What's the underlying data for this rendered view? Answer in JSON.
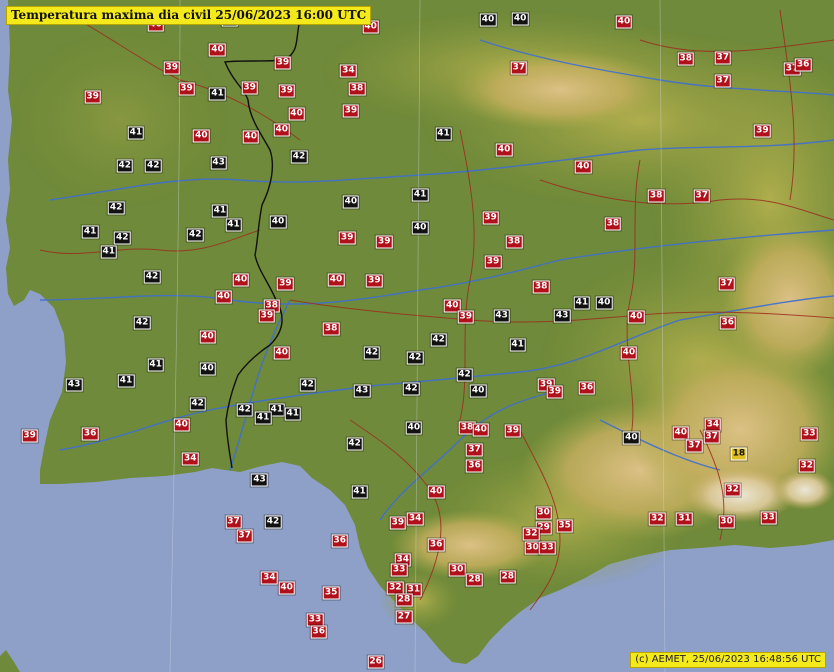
{
  "title": "Temperatura maxima dia civil   25/06/2023 16:00 UTC",
  "footer": "(c) AEMET, 25/06/2023 16:48:56 UTC",
  "colors": {
    "sea": "#8ea0c8",
    "lowland": "#6f8a3a",
    "hills": "#a9ab49",
    "mountains": "#d4b06c",
    "peaks": "#ece4d2",
    "rivers": "#3f6fd0",
    "province_borders": "#9b2d1d",
    "country_border": "#111111",
    "label_black": "#111111",
    "label_red": "#b0101a",
    "label_orange": "#e0c020",
    "title_bg": "#f3e91b"
  },
  "icons": [
    "relief-map"
  ],
  "stations": [
    {
      "value": "40",
      "lon": -6.82,
      "lat": 39.76,
      "cls": "red"
    },
    {
      "value": "40",
      "lon": -3.94,
      "lat": 39.75,
      "cls": "black"
    },
    {
      "value": "40",
      "lon": -4.2,
      "lat": 39.74,
      "cls": "black"
    },
    {
      "value": "40",
      "lon": -6.29,
      "lat": 39.74,
      "cls": "black"
    },
    {
      "value": "40",
      "lon": -6.89,
      "lat": 39.71,
      "cls": "red"
    },
    {
      "value": "40",
      "lon": -5.15,
      "lat": 39.69,
      "cls": "red"
    },
    {
      "value": "40",
      "lon": -3.1,
      "lat": 39.73,
      "cls": "red"
    },
    {
      "value": "40",
      "lon": -6.39,
      "lat": 39.53,
      "cls": "red"
    },
    {
      "value": "38",
      "lon": -2.6,
      "lat": 39.47,
      "cls": "red"
    },
    {
      "value": "37",
      "lon": -2.3,
      "lat": 39.48,
      "cls": "red"
    },
    {
      "value": "39",
      "lon": -5.86,
      "lat": 39.44,
      "cls": "red"
    },
    {
      "value": "39",
      "lon": -6.76,
      "lat": 39.41,
      "cls": "red"
    },
    {
      "value": "34",
      "lon": -5.33,
      "lat": 39.39,
      "cls": "red"
    },
    {
      "value": "37",
      "lon": -3.95,
      "lat": 39.41,
      "cls": "red"
    },
    {
      "value": "37",
      "lon": -2.3,
      "lat": 39.32,
      "cls": "red"
    },
    {
      "value": "37",
      "lon": -1.74,
      "lat": 39.4,
      "cls": "red"
    },
    {
      "value": "36",
      "lon": -1.65,
      "lat": 39.43,
      "cls": "red"
    },
    {
      "value": "39",
      "lon": -6.64,
      "lat": 39.26,
      "cls": "red"
    },
    {
      "value": "39",
      "lon": -6.13,
      "lat": 39.27,
      "cls": "red"
    },
    {
      "value": "39",
      "lon": -5.83,
      "lat": 39.25,
      "cls": "red"
    },
    {
      "value": "38",
      "lon": -5.26,
      "lat": 39.26,
      "cls": "red"
    },
    {
      "value": "41",
      "lon": -6.39,
      "lat": 39.23,
      "cls": "black"
    },
    {
      "value": "39",
      "lon": -7.4,
      "lat": 39.21,
      "cls": "red"
    },
    {
      "value": "40",
      "lon": -5.75,
      "lat": 39.09,
      "cls": "red"
    },
    {
      "value": "39",
      "lon": -5.31,
      "lat": 39.11,
      "cls": "red"
    },
    {
      "value": "40",
      "lon": -5.87,
      "lat": 38.98,
      "cls": "red"
    },
    {
      "value": "40",
      "lon": -6.12,
      "lat": 38.93,
      "cls": "red"
    },
    {
      "value": "41",
      "lon": -7.05,
      "lat": 38.96,
      "cls": "black"
    },
    {
      "value": "41",
      "lon": -4.56,
      "lat": 38.95,
      "cls": "black"
    },
    {
      "value": "40",
      "lon": -6.52,
      "lat": 38.94,
      "cls": "red"
    },
    {
      "value": "40",
      "lon": -4.07,
      "lat": 38.84,
      "cls": "red"
    },
    {
      "value": "39",
      "lon": -1.98,
      "lat": 38.97,
      "cls": "red"
    },
    {
      "value": "40",
      "lon": -3.43,
      "lat": 38.72,
      "cls": "red"
    },
    {
      "value": "42",
      "lon": -7.14,
      "lat": 38.73,
      "cls": "black"
    },
    {
      "value": "42",
      "lon": -6.91,
      "lat": 38.73,
      "cls": "black"
    },
    {
      "value": "43",
      "lon": -6.38,
      "lat": 38.75,
      "cls": "black"
    },
    {
      "value": "42",
      "lon": -5.73,
      "lat": 38.79,
      "cls": "black"
    },
    {
      "value": "41",
      "lon": -4.75,
      "lat": 38.53,
      "cls": "black"
    },
    {
      "value": "38",
      "lon": -2.84,
      "lat": 38.52,
      "cls": "red"
    },
    {
      "value": "37",
      "lon": -2.47,
      "lat": 38.52,
      "cls": "red"
    },
    {
      "value": "40",
      "lon": -5.31,
      "lat": 38.48,
      "cls": "black"
    },
    {
      "value": "42",
      "lon": -7.21,
      "lat": 38.44,
      "cls": "black"
    },
    {
      "value": "41",
      "lon": -6.37,
      "lat": 38.42,
      "cls": "black"
    },
    {
      "value": "39",
      "lon": -4.18,
      "lat": 38.37,
      "cls": "red"
    },
    {
      "value": "41",
      "lon": -6.26,
      "lat": 38.32,
      "cls": "black"
    },
    {
      "value": "40",
      "lon": -5.9,
      "lat": 38.34,
      "cls": "black"
    },
    {
      "value": "38",
      "lon": -3.19,
      "lat": 38.33,
      "cls": "red"
    },
    {
      "value": "41",
      "lon": -7.42,
      "lat": 38.27,
      "cls": "black"
    },
    {
      "value": "42",
      "lon": -7.16,
      "lat": 38.23,
      "cls": "black"
    },
    {
      "value": "42",
      "lon": -6.57,
      "lat": 38.25,
      "cls": "black"
    },
    {
      "value": "39",
      "lon": -5.34,
      "lat": 38.23,
      "cls": "red"
    },
    {
      "value": "39",
      "lon": -5.04,
      "lat": 38.2,
      "cls": "red"
    },
    {
      "value": "40",
      "lon": -4.75,
      "lat": 38.3,
      "cls": "black"
    },
    {
      "value": "38",
      "lon": -3.99,
      "lat": 38.2,
      "cls": "red"
    },
    {
      "value": "41",
      "lon": -7.27,
      "lat": 38.13,
      "cls": "black"
    },
    {
      "value": "42",
      "lon": -6.92,
      "lat": 37.96,
      "cls": "black"
    },
    {
      "value": "39",
      "lon": -4.16,
      "lat": 38.06,
      "cls": "red"
    },
    {
      "value": "40",
      "lon": -6.2,
      "lat": 37.94,
      "cls": "red"
    },
    {
      "value": "39",
      "lon": -5.84,
      "lat": 37.91,
      "cls": "red"
    },
    {
      "value": "40",
      "lon": -5.43,
      "lat": 37.94,
      "cls": "red"
    },
    {
      "value": "39",
      "lon": -5.12,
      "lat": 37.93,
      "cls": "red"
    },
    {
      "value": "38",
      "lon": -3.77,
      "lat": 37.89,
      "cls": "red"
    },
    {
      "value": "37",
      "lon": -2.27,
      "lat": 37.91,
      "cls": "red"
    },
    {
      "value": "40",
      "lon": -6.34,
      "lat": 37.82,
      "cls": "red"
    },
    {
      "value": "38",
      "lon": -5.95,
      "lat": 37.76,
      "cls": "red"
    },
    {
      "value": "39",
      "lon": -5.99,
      "lat": 37.69,
      "cls": "red"
    },
    {
      "value": "40",
      "lon": -4.49,
      "lat": 37.76,
      "cls": "red"
    },
    {
      "value": "39",
      "lon": -4.38,
      "lat": 37.68,
      "cls": "red"
    },
    {
      "value": "41",
      "lon": -3.44,
      "lat": 37.78,
      "cls": "black"
    },
    {
      "value": "40",
      "lon": -3.26,
      "lat": 37.78,
      "cls": "black"
    },
    {
      "value": "43",
      "lon": -4.09,
      "lat": 37.69,
      "cls": "black"
    },
    {
      "value": "43",
      "lon": -3.6,
      "lat": 37.69,
      "cls": "black"
    },
    {
      "value": "40",
      "lon": -3.0,
      "lat": 37.68,
      "cls": "red"
    },
    {
      "value": "42",
      "lon": -7.0,
      "lat": 37.64,
      "cls": "black"
    },
    {
      "value": "38",
      "lon": -5.47,
      "lat": 37.6,
      "cls": "red"
    },
    {
      "value": "36",
      "lon": -2.26,
      "lat": 37.64,
      "cls": "red"
    },
    {
      "value": "40",
      "lon": -6.47,
      "lat": 37.54,
      "cls": "red"
    },
    {
      "value": "42",
      "lon": -4.6,
      "lat": 37.52,
      "cls": "black"
    },
    {
      "value": "41",
      "lon": -3.96,
      "lat": 37.49,
      "cls": "black"
    },
    {
      "value": "40",
      "lon": -5.87,
      "lat": 37.43,
      "cls": "red"
    },
    {
      "value": "42",
      "lon": -5.14,
      "lat": 37.43,
      "cls": "black"
    },
    {
      "value": "42",
      "lon": -4.79,
      "lat": 37.4,
      "cls": "black"
    },
    {
      "value": "40",
      "lon": -3.06,
      "lat": 37.43,
      "cls": "red"
    },
    {
      "value": "41",
      "lon": -6.89,
      "lat": 37.35,
      "cls": "black"
    },
    {
      "value": "40",
      "lon": -6.47,
      "lat": 37.32,
      "cls": "black"
    },
    {
      "value": "42",
      "lon": -4.39,
      "lat": 37.28,
      "cls": "black"
    },
    {
      "value": "41",
      "lon": -7.13,
      "lat": 37.24,
      "cls": "black"
    },
    {
      "value": "43",
      "lon": -7.55,
      "lat": 37.21,
      "cls": "black"
    },
    {
      "value": "42",
      "lon": -5.66,
      "lat": 37.21,
      "cls": "black"
    },
    {
      "value": "43",
      "lon": -5.22,
      "lat": 37.17,
      "cls": "black"
    },
    {
      "value": "42",
      "lon": -4.82,
      "lat": 37.18,
      "cls": "black"
    },
    {
      "value": "40",
      "lon": -4.28,
      "lat": 37.17,
      "cls": "black"
    },
    {
      "value": "39",
      "lon": -3.73,
      "lat": 37.21,
      "cls": "red"
    },
    {
      "value": "39",
      "lon": -3.66,
      "lat": 37.16,
      "cls": "red"
    },
    {
      "value": "36",
      "lon": -3.4,
      "lat": 37.19,
      "cls": "red"
    },
    {
      "value": "42",
      "lon": -6.55,
      "lat": 37.08,
      "cls": "black"
    },
    {
      "value": "41",
      "lon": -5.91,
      "lat": 37.04,
      "cls": "black"
    },
    {
      "value": "41",
      "lon": -5.78,
      "lat": 37.01,
      "cls": "black"
    },
    {
      "value": "42",
      "lon": -6.17,
      "lat": 37.04,
      "cls": "black"
    },
    {
      "value": "41",
      "lon": -6.02,
      "lat": 36.98,
      "cls": "black"
    },
    {
      "value": "40",
      "lon": -6.68,
      "lat": 36.93,
      "cls": "red"
    },
    {
      "value": "40",
      "lon": -4.8,
      "lat": 36.91,
      "cls": "black"
    },
    {
      "value": "38",
      "lon": -4.37,
      "lat": 36.91,
      "cls": "red"
    },
    {
      "value": "40",
      "lon": -4.26,
      "lat": 36.9,
      "cls": "red"
    },
    {
      "value": "39",
      "lon": -4.0,
      "lat": 36.89,
      "cls": "red"
    },
    {
      "value": "40",
      "lon": -3.04,
      "lat": 36.84,
      "cls": "black"
    },
    {
      "value": "40",
      "lon": -2.64,
      "lat": 36.88,
      "cls": "red"
    },
    {
      "value": "34",
      "lon": -2.38,
      "lat": 36.93,
      "cls": "red"
    },
    {
      "value": "37",
      "lon": -2.39,
      "lat": 36.85,
      "cls": "red"
    },
    {
      "value": "37",
      "lon": -2.53,
      "lat": 36.79,
      "cls": "red"
    },
    {
      "value": "33",
      "lon": -1.6,
      "lat": 36.87,
      "cls": "red"
    },
    {
      "value": "39",
      "lon": -7.91,
      "lat": 36.86,
      "cls": "red"
    },
    {
      "value": "36",
      "lon": -7.42,
      "lat": 36.87,
      "cls": "red"
    },
    {
      "value": "42",
      "lon": -5.28,
      "lat": 36.8,
      "cls": "black"
    },
    {
      "value": "37",
      "lon": -4.31,
      "lat": 36.76,
      "cls": "red"
    },
    {
      "value": "18",
      "lon": -2.17,
      "lat": 36.73,
      "cls": "orange"
    },
    {
      "value": "34",
      "lon": -6.61,
      "lat": 36.7,
      "cls": "red"
    },
    {
      "value": "36",
      "lon": -4.31,
      "lat": 36.65,
      "cls": "red"
    },
    {
      "value": "32",
      "lon": -1.62,
      "lat": 36.65,
      "cls": "red"
    },
    {
      "value": "43",
      "lon": -6.05,
      "lat": 36.55,
      "cls": "black"
    },
    {
      "value": "41",
      "lon": -5.24,
      "lat": 36.47,
      "cls": "black"
    },
    {
      "value": "40",
      "lon": -4.62,
      "lat": 36.47,
      "cls": "red"
    },
    {
      "value": "32",
      "lon": -2.22,
      "lat": 36.48,
      "cls": "red"
    },
    {
      "value": "30",
      "lon": -3.75,
      "lat": 36.32,
      "cls": "red"
    },
    {
      "value": "32",
      "lon": -2.83,
      "lat": 36.28,
      "cls": "red"
    },
    {
      "value": "31",
      "lon": -2.61,
      "lat": 36.28,
      "cls": "red"
    },
    {
      "value": "30",
      "lon": -2.27,
      "lat": 36.26,
      "cls": "red"
    },
    {
      "value": "33",
      "lon": -1.93,
      "lat": 36.29,
      "cls": "red"
    },
    {
      "value": "37",
      "lon": -6.26,
      "lat": 36.26,
      "cls": "red"
    },
    {
      "value": "42",
      "lon": -5.94,
      "lat": 36.26,
      "cls": "black"
    },
    {
      "value": "39",
      "lon": -4.93,
      "lat": 36.25,
      "cls": "red"
    },
    {
      "value": "34",
      "lon": -4.79,
      "lat": 36.28,
      "cls": "red"
    },
    {
      "value": "29",
      "lon": -3.75,
      "lat": 36.22,
      "cls": "red"
    },
    {
      "value": "35",
      "lon": -3.58,
      "lat": 36.23,
      "cls": "red"
    },
    {
      "value": "32",
      "lon": -3.85,
      "lat": 36.18,
      "cls": "red"
    },
    {
      "value": "37",
      "lon": -6.17,
      "lat": 36.16,
      "cls": "red"
    },
    {
      "value": "36",
      "lon": -5.4,
      "lat": 36.13,
      "cls": "red"
    },
    {
      "value": "36",
      "lon": -4.62,
      "lat": 36.1,
      "cls": "red"
    },
    {
      "value": "30",
      "lon": -3.84,
      "lat": 36.08,
      "cls": "red"
    },
    {
      "value": "33",
      "lon": -3.72,
      "lat": 36.08,
      "cls": "red"
    },
    {
      "value": "34",
      "lon": -4.89,
      "lat": 36.0,
      "cls": "red"
    },
    {
      "value": "33",
      "lon": -4.92,
      "lat": 35.93,
      "cls": "red"
    },
    {
      "value": "30",
      "lon": -4.45,
      "lat": 35.93,
      "cls": "red"
    },
    {
      "value": "28",
      "lon": -4.31,
      "lat": 35.86,
      "cls": "red"
    },
    {
      "value": "28",
      "lon": -4.04,
      "lat": 35.88,
      "cls": "red"
    },
    {
      "value": "34",
      "lon": -5.97,
      "lat": 35.87,
      "cls": "red"
    },
    {
      "value": "40",
      "lon": -5.83,
      "lat": 35.8,
      "cls": "red"
    },
    {
      "value": "35",
      "lon": -5.47,
      "lat": 35.77,
      "cls": "red"
    },
    {
      "value": "32",
      "lon": -4.95,
      "lat": 35.8,
      "cls": "red"
    },
    {
      "value": "31",
      "lon": -4.8,
      "lat": 35.79,
      "cls": "red"
    },
    {
      "value": "28",
      "lon": -4.88,
      "lat": 35.72,
      "cls": "red"
    },
    {
      "value": "27",
      "lon": -4.88,
      "lat": 35.6,
      "cls": "red"
    },
    {
      "value": "33",
      "lon": -5.6,
      "lat": 35.58,
      "cls": "red"
    },
    {
      "value": "36",
      "lon": -5.57,
      "lat": 35.5,
      "cls": "red"
    },
    {
      "value": "26",
      "lon": -5.11,
      "lat": 35.29,
      "cls": "red"
    }
  ]
}
